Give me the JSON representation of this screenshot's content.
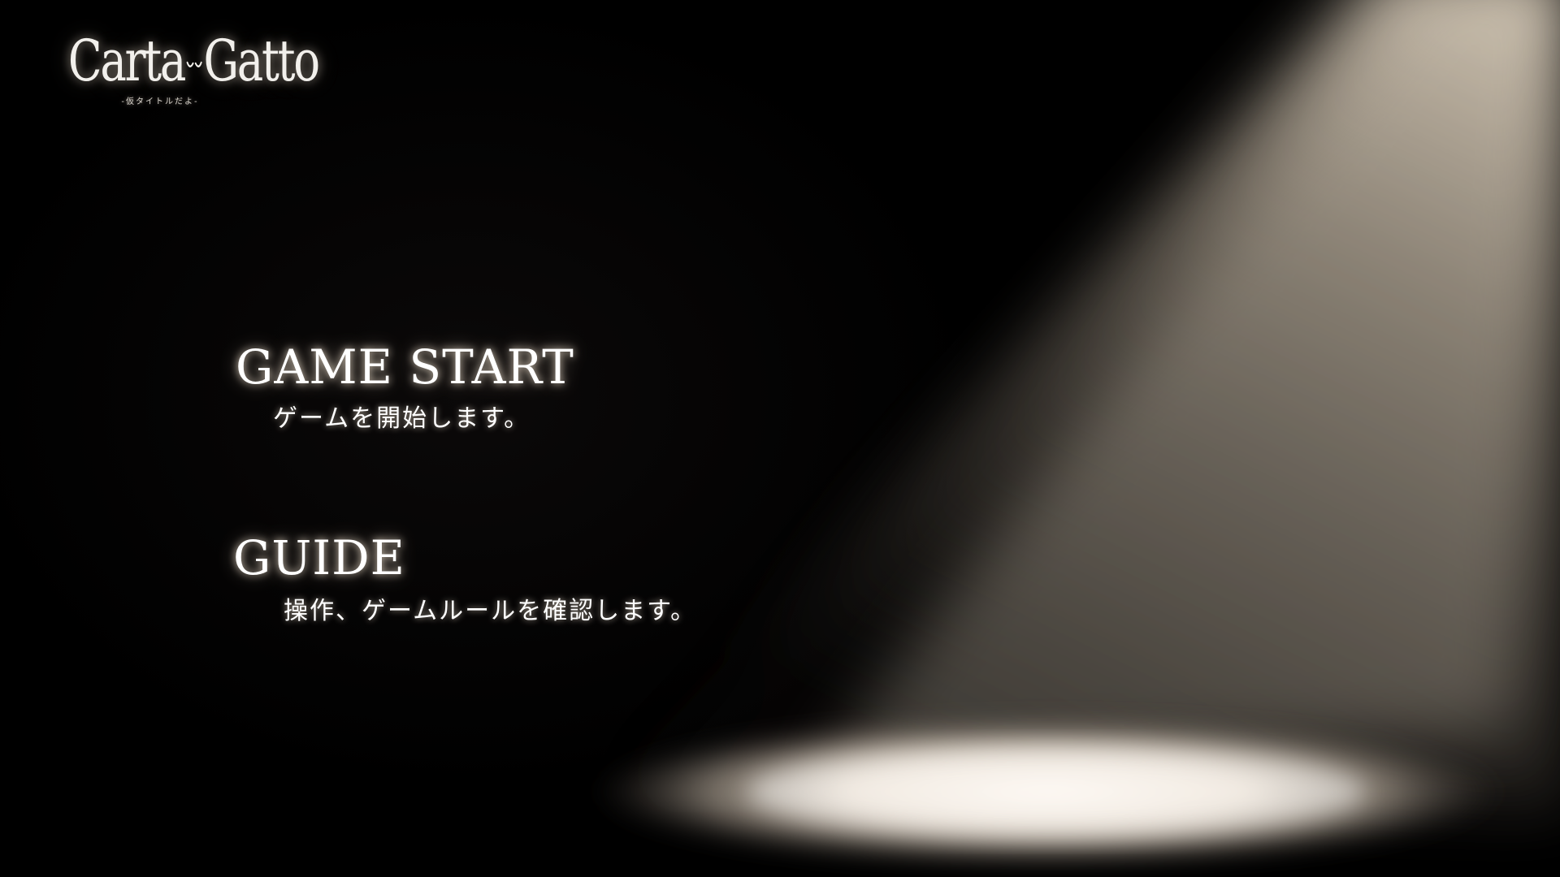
{
  "logo": {
    "title_left": "Carta",
    "title_right": "Gatto",
    "subtitle": "-仮タイトルだよ-"
  },
  "menu": {
    "start_label": "GAME START",
    "start_desc": "ゲームを開始します。",
    "guide_label": "GUIDE",
    "guide_desc": "操作、ゲームルールを確認します。"
  },
  "colors": {
    "background": "#000000",
    "text": "#ffffff",
    "spotlight": "#f3e6d2"
  },
  "icons": {
    "logo_divider": "cat-eyes-icon"
  }
}
